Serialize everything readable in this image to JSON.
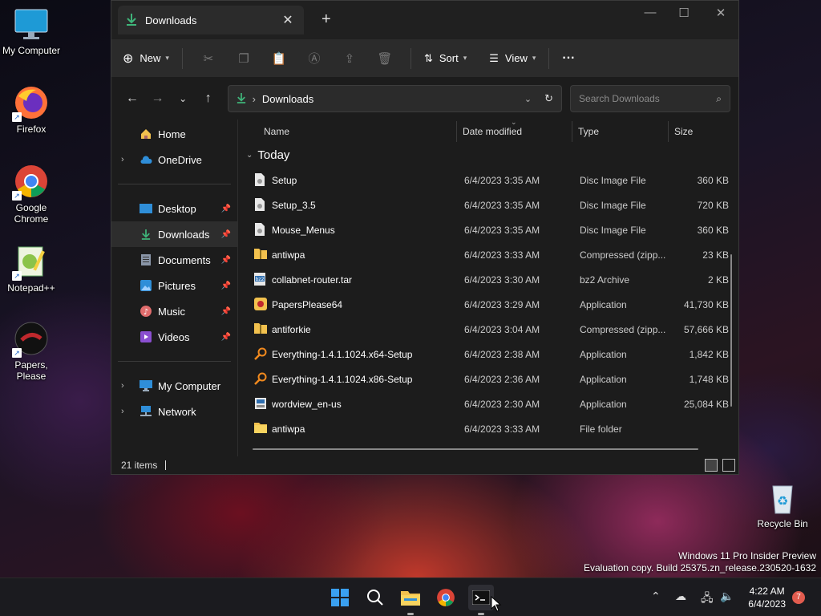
{
  "desktop": {
    "icons": [
      {
        "label": "My Computer",
        "icon": "monitor-icon"
      },
      {
        "label": "Firefox",
        "icon": "firefox-icon"
      },
      {
        "label": "Google Chrome",
        "icon": "chrome-icon"
      },
      {
        "label": "Notepad++",
        "icon": "notepadpp-icon"
      },
      {
        "label": "Papers, Please",
        "icon": "papers-please-icon"
      }
    ],
    "recycle_bin": "Recycle Bin"
  },
  "window": {
    "tab_title": "Downloads",
    "toolbar": {
      "new_label": "New",
      "sort_label": "Sort",
      "view_label": "View",
      "more_label": "···"
    },
    "address": {
      "path": "Downloads"
    },
    "search": {
      "placeholder": "Search Downloads"
    },
    "nav": {
      "home": "Home",
      "onedrive": "OneDrive",
      "desktop": "Desktop",
      "downloads": "Downloads",
      "documents": "Documents",
      "pictures": "Pictures",
      "music": "Music",
      "videos": "Videos",
      "my_computer": "My Computer",
      "network": "Network"
    },
    "columns": {
      "name": "Name",
      "date": "Date modified",
      "type": "Type",
      "size": "Size"
    },
    "group_label": "Today",
    "files": [
      {
        "name": "Setup",
        "date": "6/4/2023 3:35 AM",
        "type": "Disc Image File",
        "size": "360 KB",
        "icon": "disc-image-icon"
      },
      {
        "name": "Setup_3.5",
        "date": "6/4/2023 3:35 AM",
        "type": "Disc Image File",
        "size": "720 KB",
        "icon": "disc-image-icon"
      },
      {
        "name": "Mouse_Menus",
        "date": "6/4/2023 3:35 AM",
        "type": "Disc Image File",
        "size": "360 KB",
        "icon": "disc-image-icon"
      },
      {
        "name": "antiwpa",
        "date": "6/4/2023 3:33 AM",
        "type": "Compressed (zipp...",
        "size": "23 KB",
        "icon": "zip-folder-icon"
      },
      {
        "name": "collabnet-router.tar",
        "date": "6/4/2023 3:30 AM",
        "type": "bz2 Archive",
        "size": "2 KB",
        "icon": "bz2-archive-icon"
      },
      {
        "name": "PapersPlease64",
        "date": "6/4/2023 3:29 AM",
        "type": "Application",
        "size": "41,730 KB",
        "icon": "app-icon"
      },
      {
        "name": "antiforkie",
        "date": "6/4/2023 3:04 AM",
        "type": "Compressed (zipp...",
        "size": "57,666 KB",
        "icon": "zip-folder-icon"
      },
      {
        "name": "Everything-1.4.1.1024.x64-Setup",
        "date": "6/4/2023 2:38 AM",
        "type": "Application",
        "size": "1,842 KB",
        "icon": "search-app-icon"
      },
      {
        "name": "Everything-1.4.1.1024.x86-Setup",
        "date": "6/4/2023 2:36 AM",
        "type": "Application",
        "size": "1,748 KB",
        "icon": "search-app-icon"
      },
      {
        "name": "wordview_en-us",
        "date": "6/4/2023 2:30 AM",
        "type": "Application",
        "size": "25,084 KB",
        "icon": "installer-icon"
      },
      {
        "name": "antiwpa",
        "date": "6/4/2023 3:33 AM",
        "type": "File folder",
        "size": "",
        "icon": "folder-icon"
      }
    ],
    "status": {
      "items": "21 items"
    }
  },
  "watermark": {
    "line1": "Windows 11 Pro Insider Preview",
    "line2": "Evaluation copy. Build 25375.zn_release.230520-1632"
  },
  "taskbar": {
    "clock_time": "4:22 AM",
    "clock_date": "6/4/2023",
    "notification_count": "7"
  },
  "colors": {
    "accent": "#1e9ad6",
    "downloads_green": "#3fb57a",
    "folder_yellow": "#f2c14e"
  }
}
